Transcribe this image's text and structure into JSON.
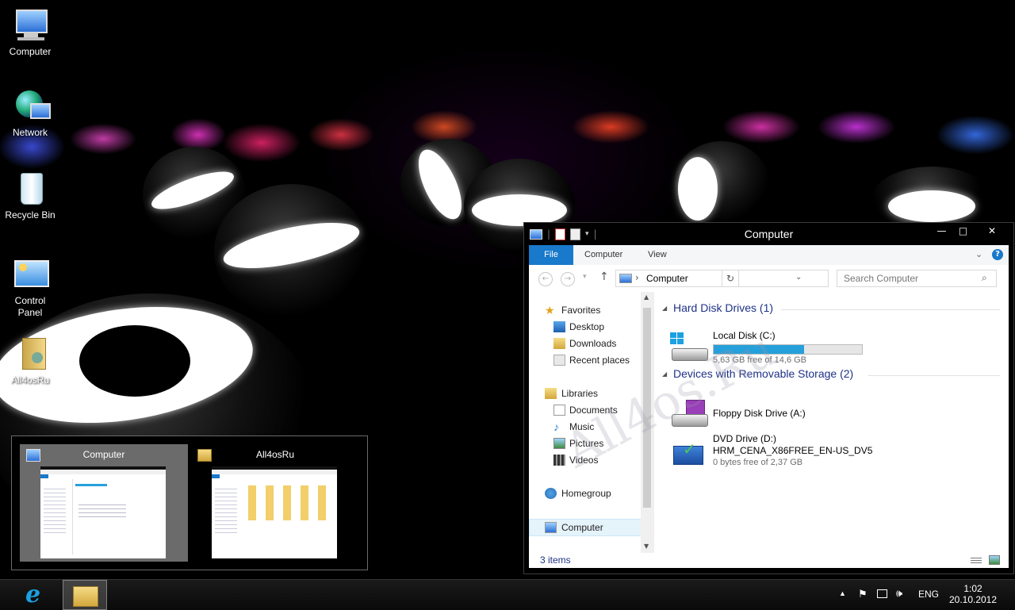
{
  "desktop": {
    "icons": [
      {
        "label": "Computer",
        "icon": "computer-icon"
      },
      {
        "label": "Network",
        "icon": "network-icon"
      },
      {
        "label": "Recycle Bin",
        "icon": "recycle-bin-icon"
      },
      {
        "label": "Control\nPanel",
        "label_line1": "Control",
        "label_line2": "Panel",
        "icon": "control-panel-icon"
      },
      {
        "label": "All4osRu",
        "icon": "user-folder-icon"
      }
    ]
  },
  "switcher": {
    "items": [
      {
        "title": "Computer",
        "icon": "computer-icon",
        "active": true
      },
      {
        "title": "All4osRu",
        "icon": "folder-icon",
        "active": false
      }
    ]
  },
  "window": {
    "title": "Computer",
    "caption_buttons": {
      "minimize": "—",
      "maximize": "□",
      "close": "✕"
    },
    "ribbon": {
      "tabs": [
        "File",
        "Computer",
        "View"
      ],
      "help": "?"
    },
    "address": {
      "location": "Computer",
      "separator": "›"
    },
    "search": {
      "placeholder": "Search Computer"
    },
    "nav": {
      "favorites": {
        "label": "Favorites",
        "items": [
          "Desktop",
          "Downloads",
          "Recent places"
        ]
      },
      "libraries": {
        "label": "Libraries",
        "items": [
          "Documents",
          "Music",
          "Pictures",
          "Videos"
        ]
      },
      "homegroup": "Homegroup",
      "computer": "Computer"
    },
    "groups": {
      "hard_disks": {
        "title": "Hard Disk Drives (1)",
        "drives": [
          {
            "name": "Local Disk (C:)",
            "free": "5,63 GB free of 14,6 GB",
            "used_fraction": 0.61
          }
        ]
      },
      "removable": {
        "title": "Devices with Removable Storage (2)",
        "drives": [
          {
            "name": "Floppy Disk Drive (A:)"
          },
          {
            "name": "DVD Drive (D:)",
            "label": "HRM_CENA_X86FREE_EN-US_DV5",
            "free": "0 bytes free of 2,37 GB"
          }
        ]
      }
    },
    "status": {
      "items": "3 items"
    }
  },
  "watermark": "All4os.Ru",
  "taskbar": {
    "tray": {
      "language": "ENG",
      "time": "1:02",
      "date": "20.10.2012"
    }
  },
  "colors": {
    "file_tab": "#1979ca",
    "group_header": "#1e3287",
    "progress": "#26a0da",
    "selection": "#e5f3fb"
  }
}
